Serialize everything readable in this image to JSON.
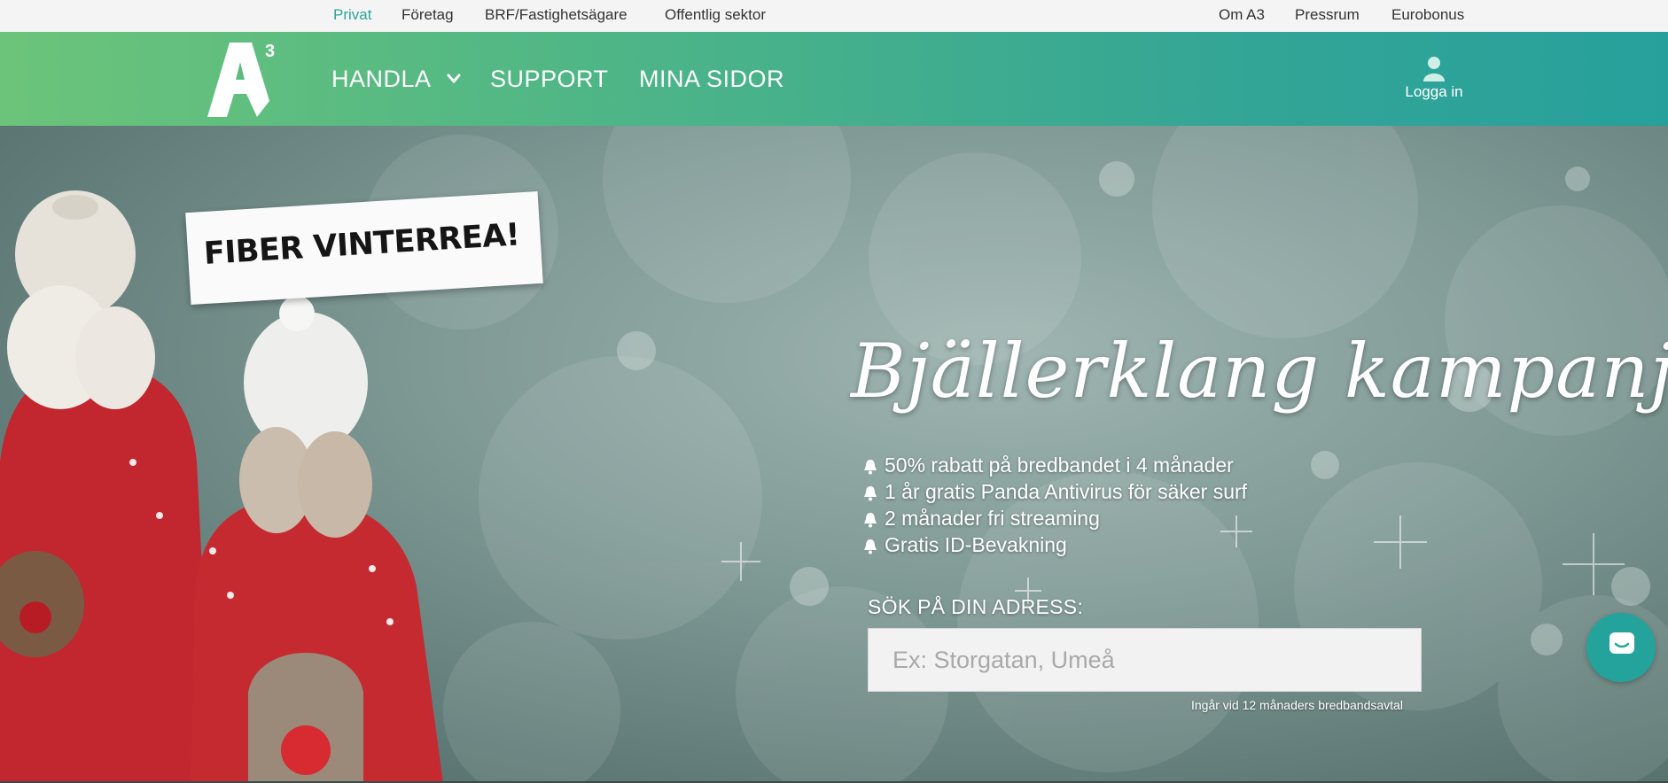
{
  "topbar": {
    "left_links": [
      "Privat",
      "Företag",
      "BRF/Fastighetsägare",
      "Offentlig sektor"
    ],
    "right_links": [
      "Om A3",
      "Pressrum",
      "Eurobonus"
    ],
    "active": "Privat",
    "active_color": "#2fa39a"
  },
  "header": {
    "logo_text": "A3",
    "nav": [
      "HANDLA",
      "SUPPORT",
      "MINA SIDOR"
    ],
    "login_label": "Logga in",
    "login_icon": "user-icon"
  },
  "hero": {
    "ribbon_text": "FIBER VINTERREA!",
    "title": "Bjällerklang kampanj",
    "bullets": [
      "50% rabatt på bredbandet i 4 månader",
      "1 år gratis Panda Antivirus för säker surf",
      "2 månader fri streaming",
      "Gratis ID-Bevakning"
    ],
    "bullet_icon": "bell-icon",
    "search_label": "SÖK PÅ DIN ADRESS:",
    "search_placeholder": "Ex: Storgatan, Umeå",
    "search_value": "",
    "disclaimer": "Ingår vid 12 månaders bredbandsavtal"
  },
  "chat": {
    "icon": "chat-icon"
  },
  "colors": {
    "header_gradient_start": "#6cc47a",
    "header_gradient_end": "#27a09c",
    "chat_button": "#24a39c"
  }
}
